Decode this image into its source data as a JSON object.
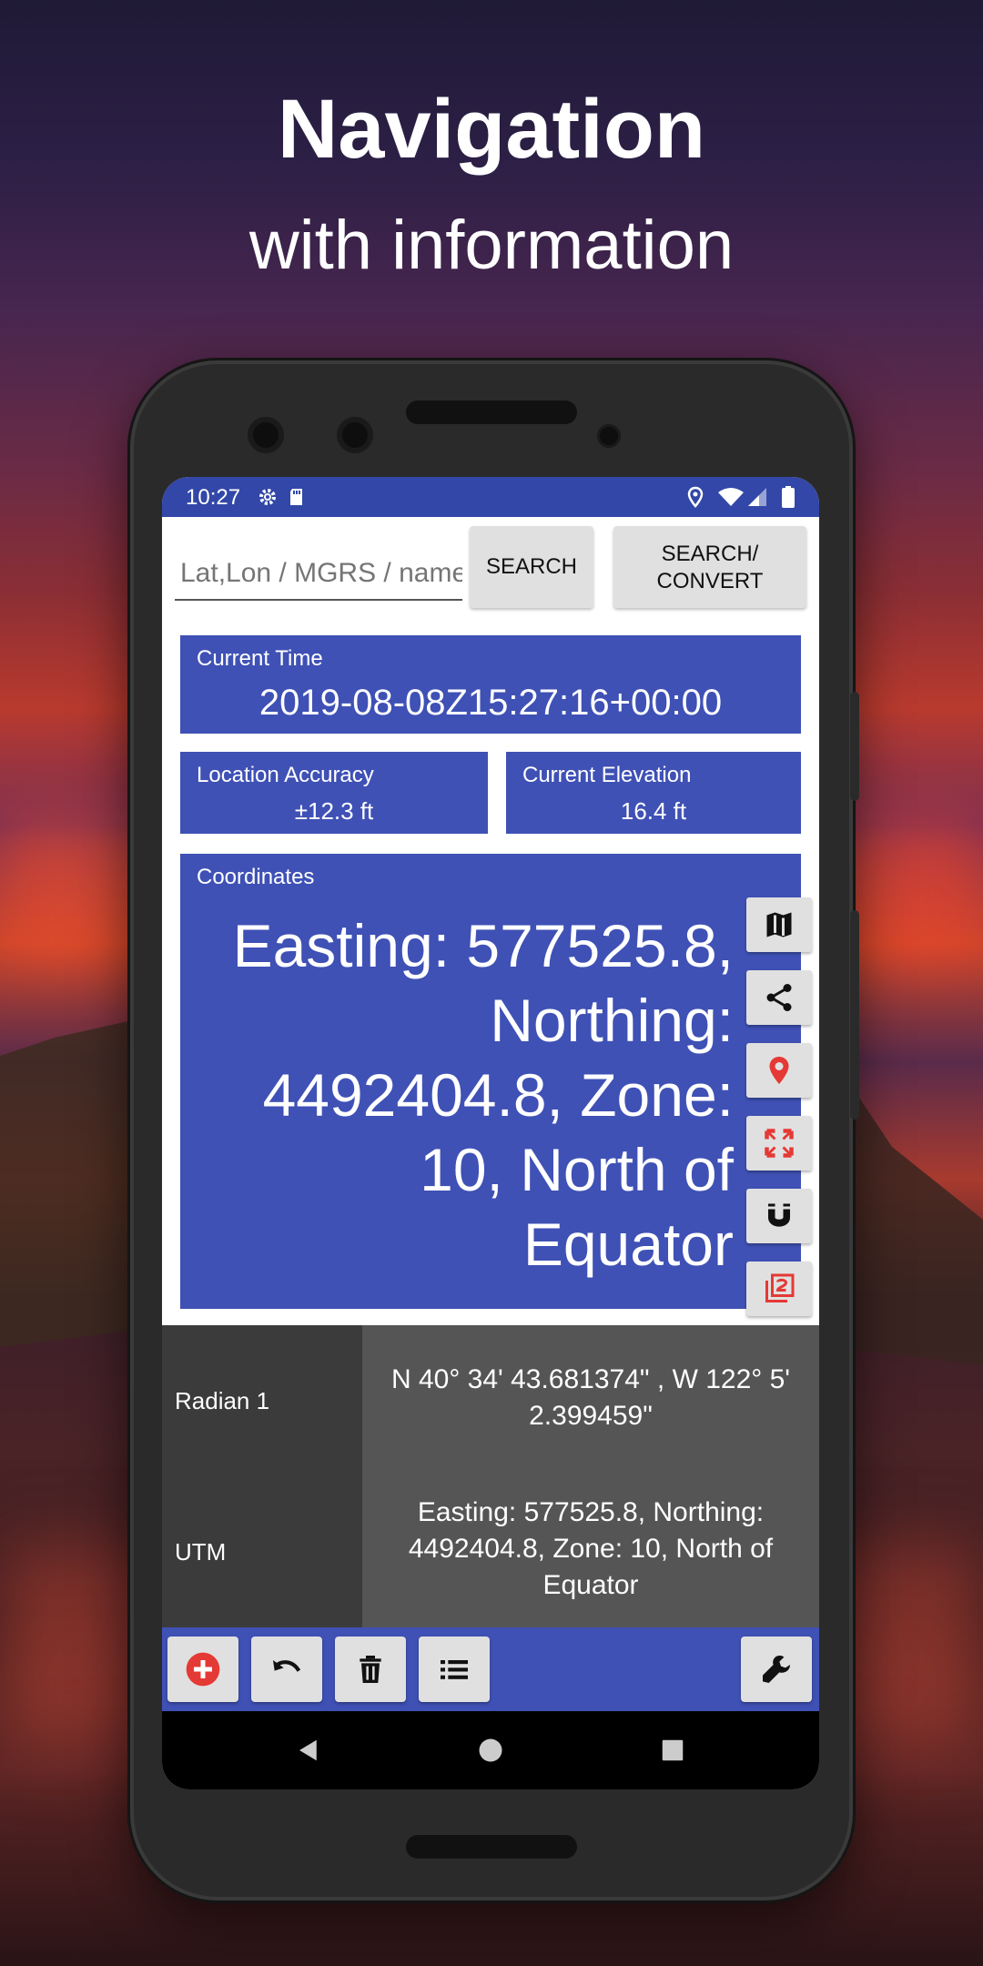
{
  "headline": {
    "title": "Navigation",
    "subtitle": "with information"
  },
  "status_bar": {
    "time": "10:27"
  },
  "search": {
    "placeholder": "Lat,Lon / MGRS / name",
    "search_label": "SEARCH",
    "convert_label_line1": "SEARCH/",
    "convert_label_line2": "CONVERT"
  },
  "current_time": {
    "label": "Current Time",
    "value": "2019-08-08Z15:27:16+00:00"
  },
  "location_accuracy": {
    "label": "Location Accuracy",
    "value": "±12.3 ft"
  },
  "current_elevation": {
    "label": "Current Elevation",
    "value": "16.4 ft"
  },
  "coordinates": {
    "label": "Coordinates",
    "value": "Easting: 577525.8, Northing: 4492404.8, Zone: 10, North of Equator"
  },
  "side_tools": [
    "map-icon",
    "share-icon",
    "location-pin-icon",
    "fullscreen-icon",
    "magnet-icon",
    "filter-two-icon"
  ],
  "rows": [
    {
      "label": "Radian 1",
      "value": "N 40° 34' 43.681374\" , W 122° 5' 2.399459\""
    },
    {
      "label": "UTM",
      "value": "Easting: 577525.8, Northing: 4492404.8, Zone: 10, North of Equator"
    }
  ],
  "toolbar": [
    "add-icon",
    "undo-icon",
    "trash-icon",
    "list-icon",
    "wrench-icon"
  ],
  "colors": {
    "primary": "#3f51b5",
    "status_bar": "#3247a7",
    "accent_red": "#e53935"
  }
}
